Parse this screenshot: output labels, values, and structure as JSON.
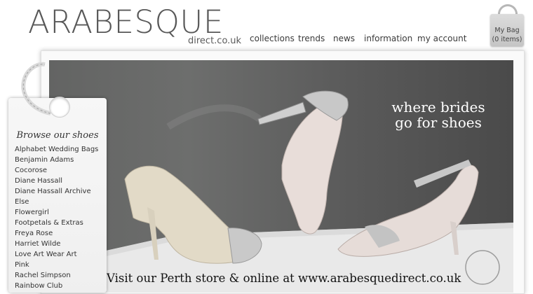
{
  "logo": {
    "main": "ARABESQUE",
    "sub": "direct.co.uk"
  },
  "nav": {
    "items": [
      "collections",
      "trends",
      "news",
      "information",
      "my account"
    ]
  },
  "bag": {
    "title": "My Bag",
    "count": "(0 items)"
  },
  "hero": {
    "tagline_line1": "where brides",
    "tagline_line2": "go for shoes",
    "banner": "Visit our Perth store & online at www.arabesquedirect.co.uk"
  },
  "sidebar": {
    "title": "Browse our shoes",
    "items": [
      "Alphabet Wedding Bags",
      "Benjamin Adams",
      "Cocorose",
      "Diane Hassall",
      "Diane Hassall Archive",
      "Else",
      "Flowergirl",
      "Footpetals & Extras",
      "Freya Rose",
      "Harriet Wilde",
      "Love Art Wear Art",
      "Pink",
      "Rachel Simpson",
      "Rainbow Club"
    ]
  },
  "colors": {
    "text": "#3c3c3c",
    "logo": "#585858",
    "photo_bg": "#636463"
  }
}
